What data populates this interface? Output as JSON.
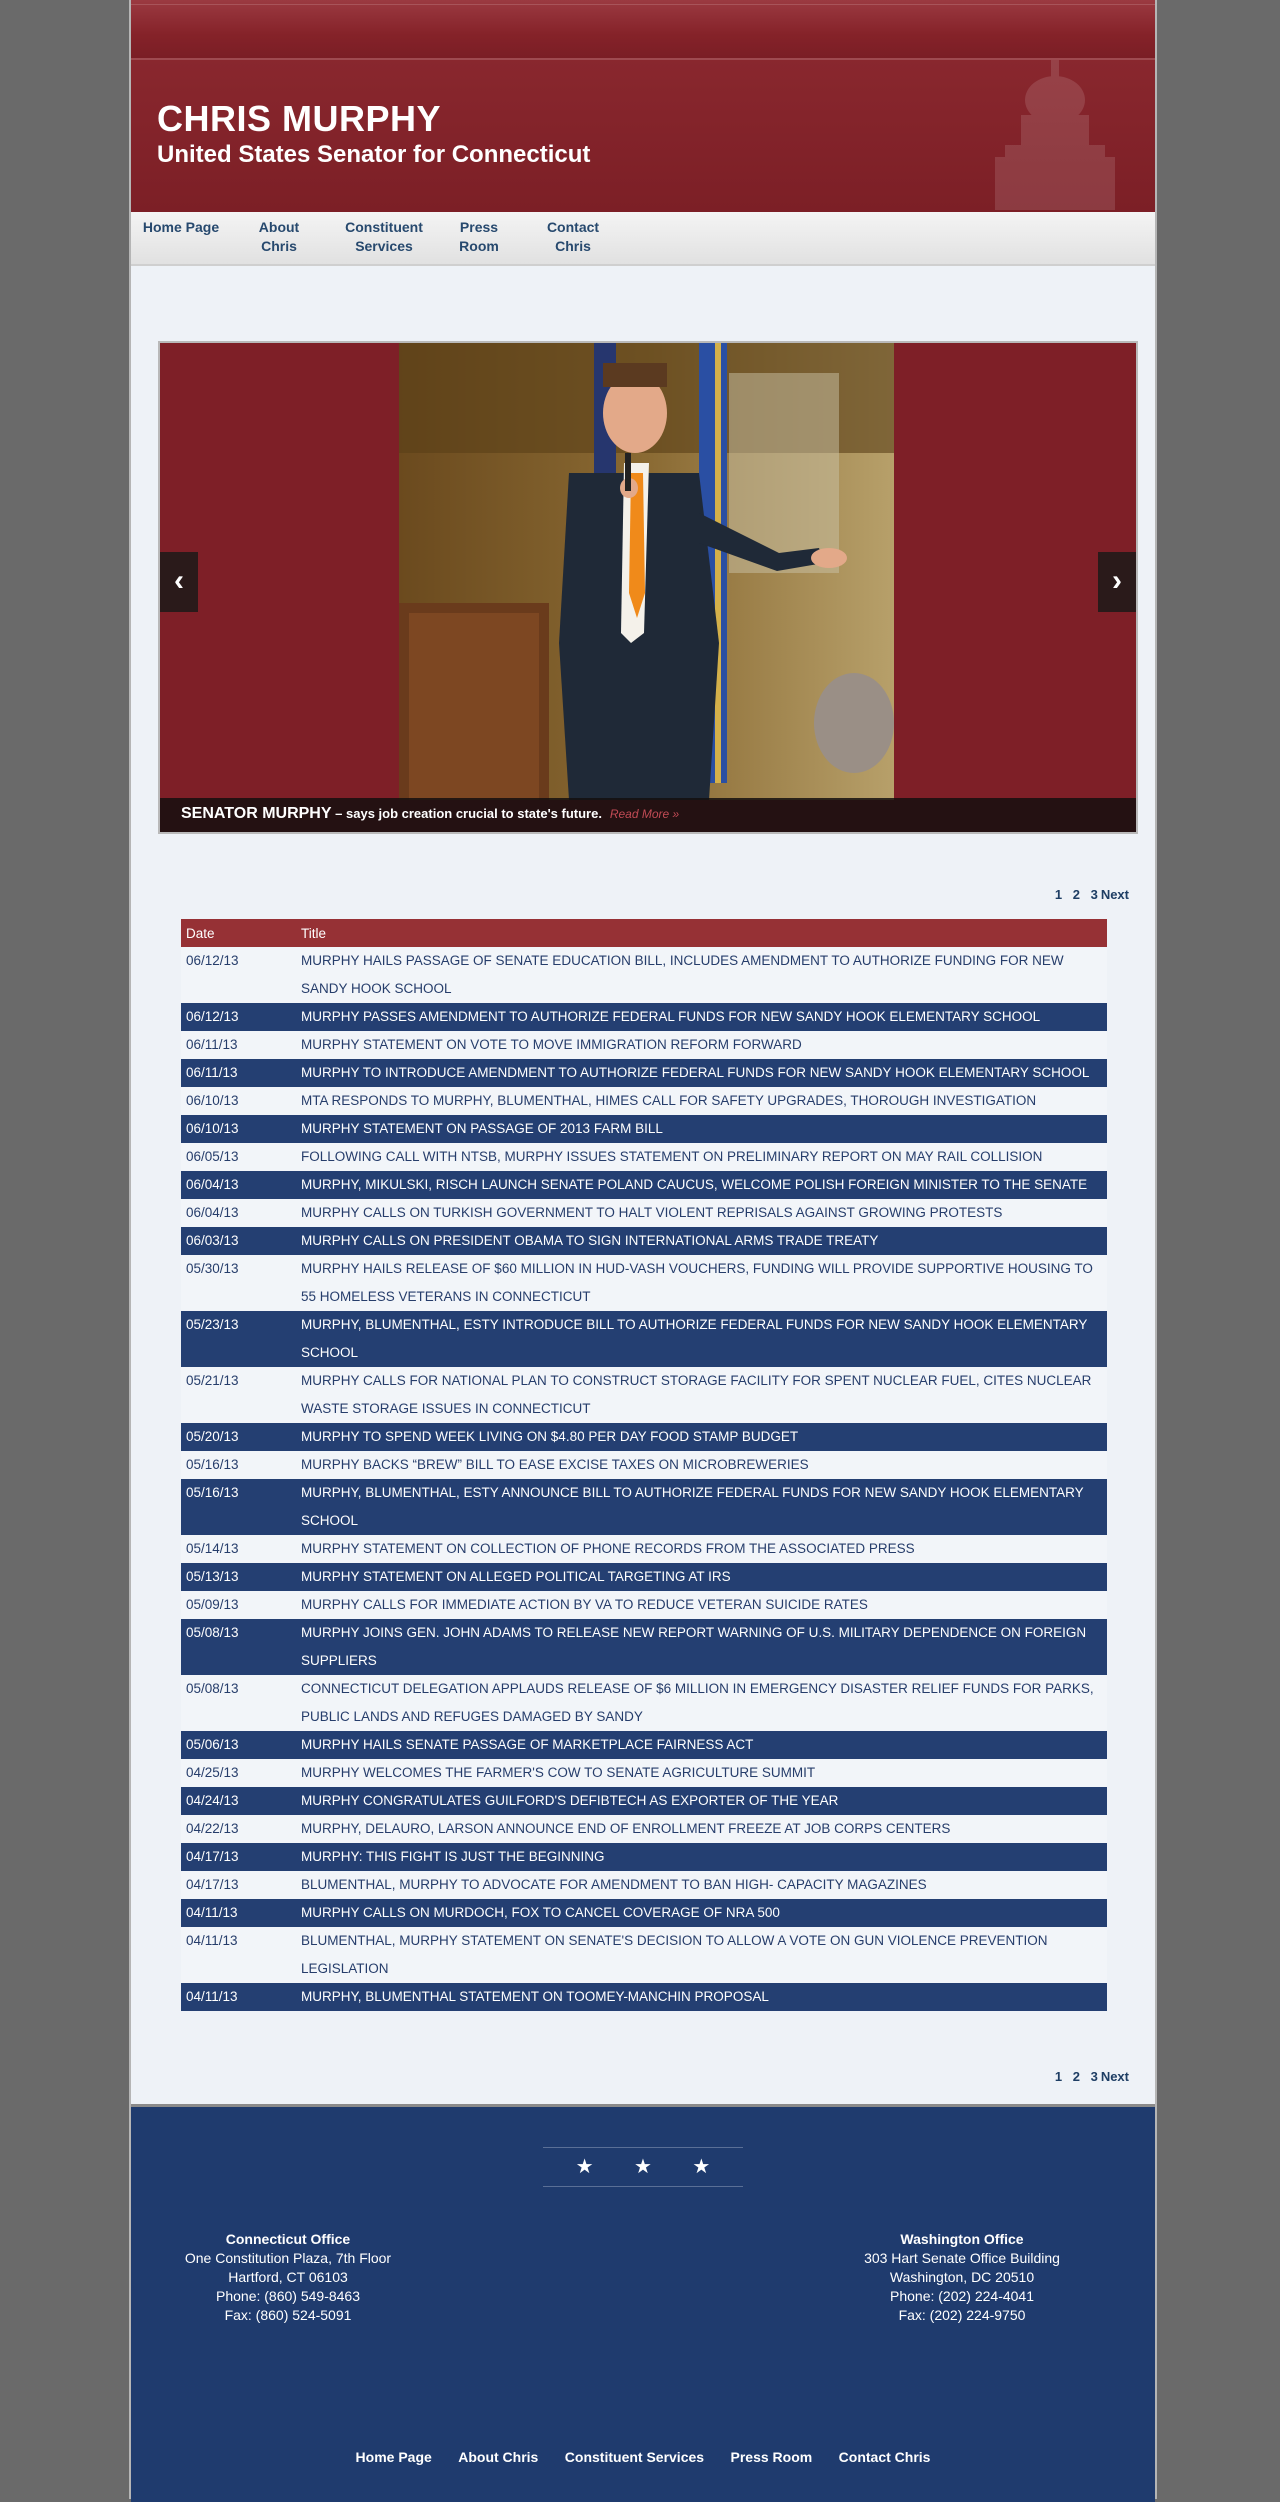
{
  "header": {
    "title": "CHRIS MURPHY",
    "subtitle": "United States Senator for Connecticut"
  },
  "nav": [
    {
      "label": "Home Page"
    },
    {
      "label": "About Chris"
    },
    {
      "label": "Constituent Services"
    },
    {
      "label": "Press Room"
    },
    {
      "label": "Contact Chris"
    }
  ],
  "slider": {
    "caption_name": "SENATOR MURPHY",
    "caption_dash": " – ",
    "caption_text": "says job creation crucial to state's future.",
    "read_more": "Read More »",
    "prev_icon": "‹",
    "next_icon": "›"
  },
  "pagination": {
    "pages": [
      "1",
      "2",
      "3"
    ],
    "next": "Next"
  },
  "table": {
    "headers": {
      "date": "Date",
      "title": "Title"
    },
    "rows": [
      {
        "date": "06/12/13",
        "title": "MURPHY HAILS PASSAGE OF SENATE EDUCATION BILL, INCLUDES AMENDMENT TO AUTHORIZE FUNDING FOR NEW SANDY HOOK SCHOOL"
      },
      {
        "date": "06/12/13",
        "title": "MURPHY PASSES AMENDMENT TO AUTHORIZE FEDERAL FUNDS FOR NEW SANDY HOOK ELEMENTARY SCHOOL"
      },
      {
        "date": "06/11/13",
        "title": "MURPHY STATEMENT ON VOTE TO MOVE IMMIGRATION REFORM FORWARD"
      },
      {
        "date": "06/11/13",
        "title": "MURPHY TO INTRODUCE AMENDMENT TO AUTHORIZE FEDERAL FUNDS FOR NEW SANDY HOOK ELEMENTARY SCHOOL"
      },
      {
        "date": "06/10/13",
        "title": "MTA RESPONDS TO MURPHY, BLUMENTHAL, HIMES CALL FOR SAFETY UPGRADES, THOROUGH INVESTIGATION"
      },
      {
        "date": "06/10/13",
        "title": "MURPHY STATEMENT ON PASSAGE OF 2013 FARM BILL"
      },
      {
        "date": "06/05/13",
        "title": "FOLLOWING CALL WITH NTSB, MURPHY ISSUES STATEMENT ON PRELIMINARY REPORT ON MAY RAIL COLLISION"
      },
      {
        "date": "06/04/13",
        "title": "MURPHY, MIKULSKI, RISCH LAUNCH SENATE POLAND CAUCUS, WELCOME POLISH FOREIGN MINISTER TO THE SENATE"
      },
      {
        "date": "06/04/13",
        "title": "MURPHY CALLS ON TURKISH GOVERNMENT TO HALT VIOLENT REPRISALS AGAINST GROWING PROTESTS"
      },
      {
        "date": "06/03/13",
        "title": "MURPHY CALLS ON PRESIDENT OBAMA TO SIGN INTERNATIONAL ARMS TRADE TREATY"
      },
      {
        "date": "05/30/13",
        "title": "MURPHY HAILS RELEASE OF $60 MILLION IN HUD-VASH VOUCHERS, FUNDING WILL PROVIDE SUPPORTIVE HOUSING TO 55 HOMELESS VETERANS IN CONNECTICUT"
      },
      {
        "date": "05/23/13",
        "title": "MURPHY, BLUMENTHAL, ESTY INTRODUCE BILL TO AUTHORIZE FEDERAL FUNDS FOR NEW SANDY HOOK ELEMENTARY SCHOOL"
      },
      {
        "date": "05/21/13",
        "title": "MURPHY CALLS FOR NATIONAL PLAN TO CONSTRUCT STORAGE FACILITY FOR SPENT NUCLEAR FUEL, CITES NUCLEAR WASTE STORAGE ISSUES IN CONNECTICUT"
      },
      {
        "date": "05/20/13",
        "title": "MURPHY TO SPEND WEEK LIVING ON $4.80 PER DAY FOOD STAMP BUDGET"
      },
      {
        "date": "05/16/13",
        "title": "MURPHY BACKS “BREW” BILL TO EASE EXCISE TAXES ON MICROBREWERIES"
      },
      {
        "date": "05/16/13",
        "title": "MURPHY, BLUMENTHAL, ESTY ANNOUNCE BILL TO AUTHORIZE FEDERAL FUNDS FOR NEW SANDY HOOK ELEMENTARY SCHOOL"
      },
      {
        "date": "05/14/13",
        "title": "MURPHY STATEMENT ON COLLECTION OF PHONE RECORDS FROM THE ASSOCIATED PRESS"
      },
      {
        "date": "05/13/13",
        "title": "MURPHY STATEMENT ON ALLEGED POLITICAL TARGETING AT IRS"
      },
      {
        "date": "05/09/13",
        "title": "MURPHY CALLS FOR IMMEDIATE ACTION BY VA TO REDUCE VETERAN SUICIDE RATES"
      },
      {
        "date": "05/08/13",
        "title": "MURPHY JOINS GEN. JOHN ADAMS TO RELEASE NEW REPORT WARNING OF U.S. MILITARY DEPENDENCE ON FOREIGN SUPPLIERS"
      },
      {
        "date": "05/08/13",
        "title": "CONNECTICUT DELEGATION APPLAUDS RELEASE OF $6 MILLION IN EMERGENCY DISASTER RELIEF FUNDS FOR PARKS, PUBLIC LANDS AND REFUGES DAMAGED BY SANDY"
      },
      {
        "date": "05/06/13",
        "title": "MURPHY HAILS SENATE PASSAGE OF MARKETPLACE FAIRNESS ACT"
      },
      {
        "date": "04/25/13",
        "title": "MURPHY WELCOMES THE FARMER'S COW TO SENATE AGRICULTURE SUMMIT"
      },
      {
        "date": "04/24/13",
        "title": "MURPHY CONGRATULATES GUILFORD'S DEFIBTECH AS EXPORTER OF THE YEAR"
      },
      {
        "date": "04/22/13",
        "title": "MURPHY, DELAURO, LARSON ANNOUNCE END OF ENROLLMENT FREEZE AT JOB CORPS CENTERS"
      },
      {
        "date": "04/17/13",
        "title": "MURPHY: THIS FIGHT IS JUST THE BEGINNING"
      },
      {
        "date": "04/17/13",
        "title": "BLUMENTHAL, MURPHY TO ADVOCATE FOR AMENDMENT TO BAN HIGH- CAPACITY MAGAZINES"
      },
      {
        "date": "04/11/13",
        "title": "MURPHY CALLS ON MURDOCH, FOX TO CANCEL COVERAGE OF NRA 500"
      },
      {
        "date": "04/11/13",
        "title": "BLUMENTHAL, MURPHY STATEMENT ON SENATE'S DECISION TO ALLOW A VOTE ON GUN VIOLENCE PREVENTION LEGISLATION"
      },
      {
        "date": "04/11/13",
        "title": "MURPHY, BLUMENTHAL STATEMENT ON TOOMEY-MANCHIN PROPOSAL"
      }
    ]
  },
  "footer": {
    "star_icon": "★",
    "ct_office": {
      "name": "Connecticut Office",
      "line1": "One Constitution Plaza, 7th Floor",
      "line2": "Hartford, CT 06103",
      "phone": "Phone: (860) 549-8463",
      "fax": "Fax: (860) 524-5091"
    },
    "dc_office": {
      "name": "Washington Office",
      "line1": "303 Hart Senate Office Building",
      "line2": "Washington, DC 20510",
      "phone": "Phone: (202) 224-4041",
      "fax": "Fax: (202) 224-9750"
    },
    "links": [
      "Home Page",
      "About Chris",
      "Constituent Services",
      "Press Room",
      "Contact Chris"
    ]
  },
  "colors": {
    "header_red": "#86252c",
    "nav_text": "#27496e",
    "row_blue": "#243f72",
    "footer_blue": "#1f3b6e"
  }
}
